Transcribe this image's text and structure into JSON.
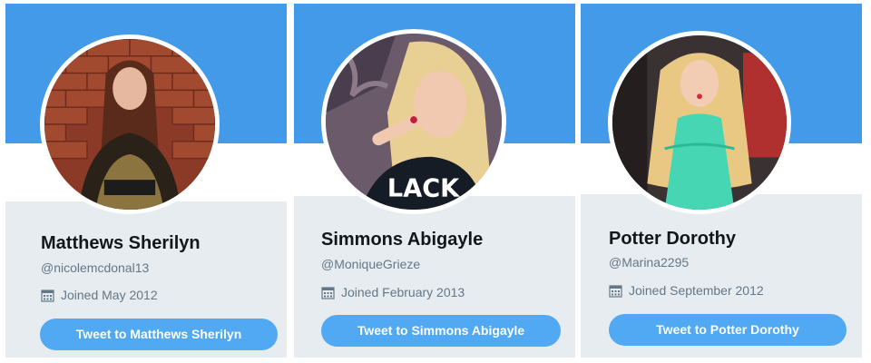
{
  "cards": [
    {
      "name": "Matthews Sherilyn",
      "handle": "@nicolemcdonal13",
      "joined": "Joined May 2012",
      "button_label": "Tweet to Matthews Sherilyn"
    },
    {
      "name": "Simmons Abigayle",
      "handle": "@MoniqueGrieze",
      "joined": "Joined February 2013",
      "button_label": "Tweet to Simmons Abigayle"
    },
    {
      "name": "Potter Dorothy",
      "handle": "@Marina2295",
      "joined": "Joined September 2012",
      "button_label": "Tweet to Potter Dorothy"
    }
  ],
  "colors": {
    "header_blue": "#439ae9",
    "button_blue": "#50a9f2",
    "card_background": "#e6ecf0",
    "name_text": "#14171a",
    "muted_text": "#657786"
  },
  "icons": {
    "joined": "calendar-icon"
  }
}
